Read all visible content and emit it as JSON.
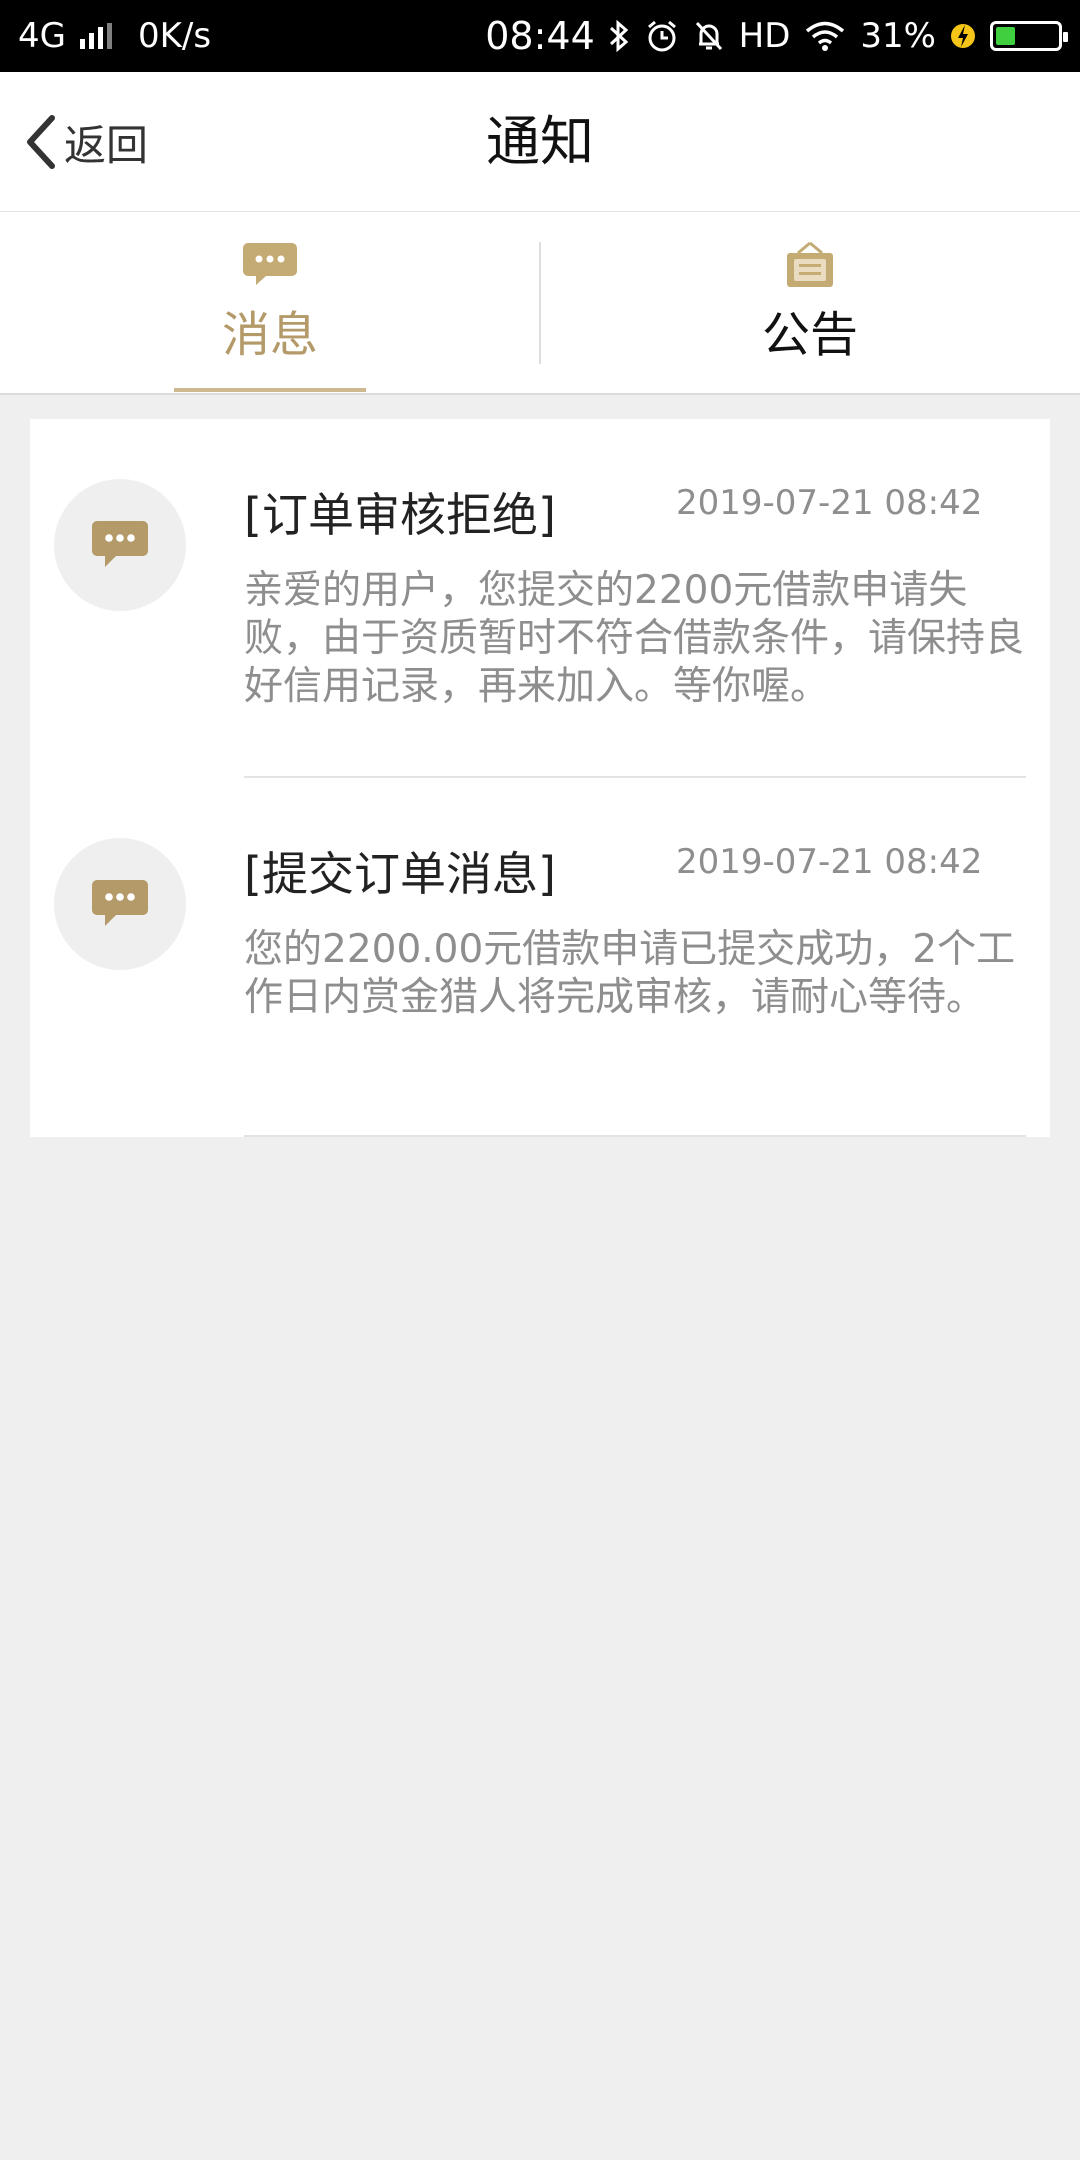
{
  "status_bar": {
    "network": "4G",
    "speed": "0K/s",
    "time": "08:44",
    "hd": "HD",
    "battery_percent": "31%",
    "battery_level": 0.31
  },
  "header": {
    "back_label": "返回",
    "title": "通知"
  },
  "tabs": [
    {
      "label": "消息",
      "icon": "chat-bubble-icon",
      "active": true
    },
    {
      "label": "公告",
      "icon": "announcement-board-icon",
      "active": false
    }
  ],
  "messages": [
    {
      "title": "[订单审核拒绝]",
      "time": "2019-07-21 08:42",
      "body": "亲爱的用户，您提交的2200元借款申请失败，由于资质暂时不符合借款条件，请保持良好信用记录，再来加入。等你喔。"
    },
    {
      "title": "[提交订单消息]",
      "time": "2019-07-21 08:42",
      "body": "您的2200.00元借款申请已提交成功，2个工作日内赏金猎人将完成审核，请耐心等待。"
    }
  ],
  "colors": {
    "accent": "#b49a68",
    "status_bar_bg": "#000000",
    "page_bg": "#efefef",
    "battery_fill": "#3fcf3f",
    "charging": "#f5c518"
  }
}
